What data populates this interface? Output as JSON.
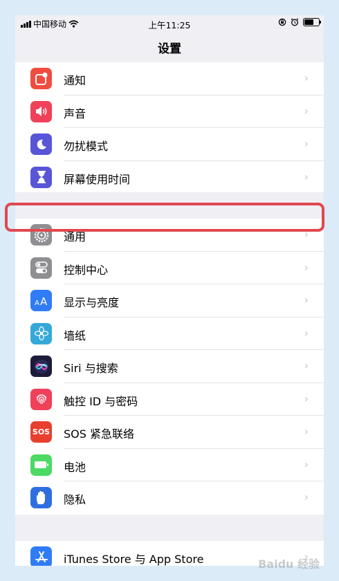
{
  "status": {
    "carrier": "中国移动",
    "time": "上午11:25"
  },
  "nav": {
    "title": "设置"
  },
  "group1": [
    {
      "label": "通知",
      "icon": "notifications-icon",
      "color": "#f04c3f"
    },
    {
      "label": "声音",
      "icon": "sound-icon",
      "color": "#f0405a"
    },
    {
      "label": "勿扰模式",
      "icon": "moon-icon",
      "color": "#5856d6"
    },
    {
      "label": "屏幕使用时间",
      "icon": "hourglass-icon",
      "color": "#5856d6"
    }
  ],
  "group2": [
    {
      "label": "通用",
      "icon": "gear-icon",
      "color": "#8e8e93"
    },
    {
      "label": "控制中心",
      "icon": "toggles-icon",
      "color": "#8e8e93"
    },
    {
      "label": "显示与亮度",
      "icon": "text-size-icon",
      "color": "#2f7cf6"
    },
    {
      "label": "墙纸",
      "icon": "flower-icon",
      "color": "#36a8d8"
    },
    {
      "label": "Siri 与搜索",
      "icon": "siri-icon",
      "color": "#1c1c3a"
    },
    {
      "label": "触控 ID 与密码",
      "icon": "fingerprint-icon",
      "color": "#f0405a"
    },
    {
      "label": "SOS 紧急联络",
      "icon": "sos-icon",
      "color": "#e8402f",
      "icon_text": "SOS"
    },
    {
      "label": "电池",
      "icon": "battery-icon",
      "color": "#4cd964"
    },
    {
      "label": "隐私",
      "icon": "hand-icon",
      "color": "#2f6ee0"
    }
  ],
  "group3": [
    {
      "label": "iTunes Store 与 App Store",
      "icon": "app-store-icon",
      "color": "#2f7cf6"
    }
  ],
  "chevron": "›",
  "watermark": "Baidu 经验"
}
